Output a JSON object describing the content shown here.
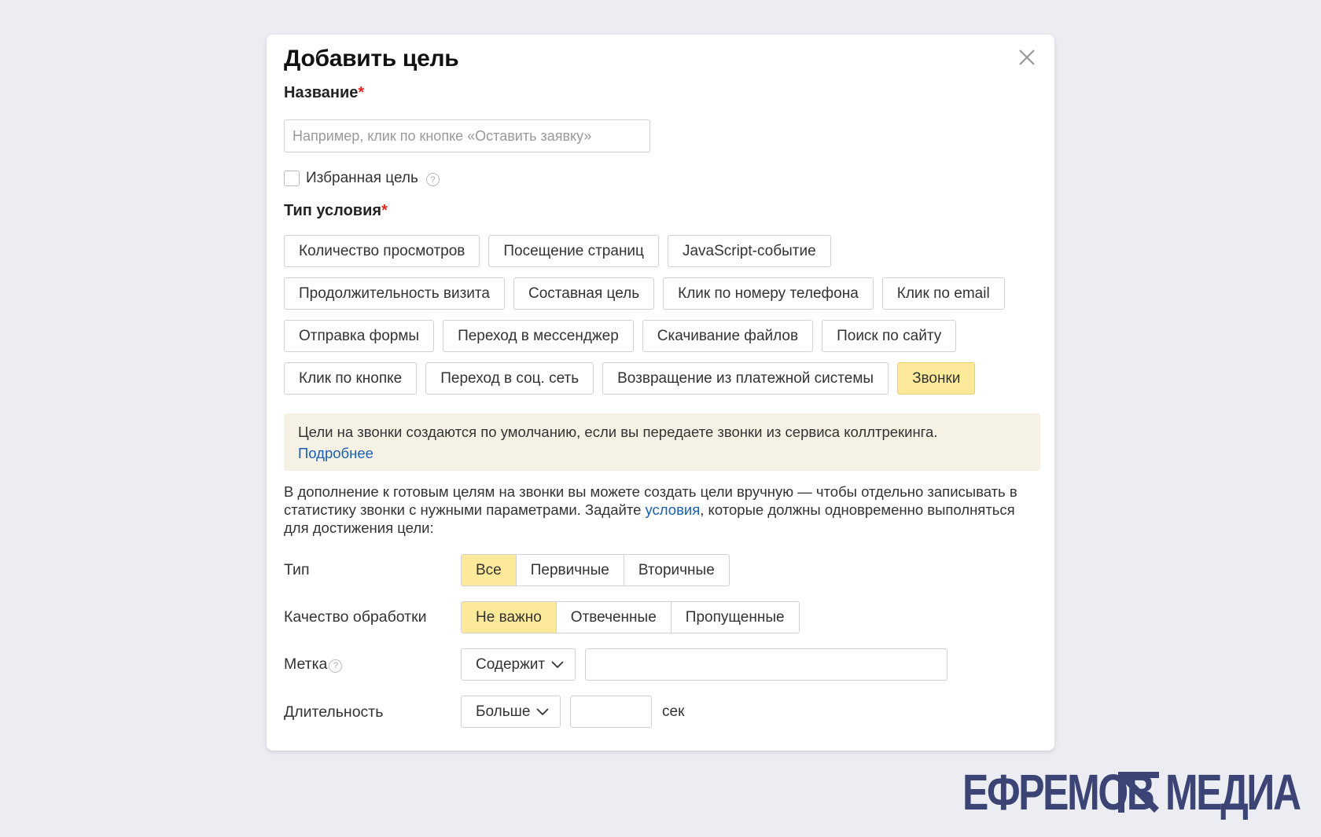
{
  "dialog": {
    "title": "Добавить цель",
    "close_icon": "close-icon"
  },
  "name_field": {
    "label": "Название",
    "required_mark": "*",
    "placeholder": "Например, клик по кнопке «Оставить заявку»",
    "value": ""
  },
  "favorite": {
    "label": "Избранная цель",
    "checked": false,
    "help_icon": "question-circle-icon"
  },
  "condition_type": {
    "label": "Тип условия",
    "required_mark": "*",
    "rows": [
      [
        "Количество просмотров",
        "Посещение страниц",
        "JavaScript-событие"
      ],
      [
        "Продолжительность визита",
        "Составная цель",
        "Клик по номеру телефона",
        "Клик по email"
      ],
      [
        "Отправка формы",
        "Переход в мессенджер",
        "Скачивание файлов",
        "Поиск по сайту"
      ],
      [
        "Клик по кнопке",
        "Переход в соц. сеть",
        "Возвращение из платежной системы",
        "Звонки"
      ]
    ],
    "selected": "Звонки"
  },
  "info": {
    "text": "Цели на звонки создаются по умолчанию, если вы передаете звонки из сервиса коллтрекинга.",
    "link": "Подробнее"
  },
  "description": {
    "before_link": "В дополнение к готовым целям на звонки вы можете создать цели вручную — чтобы отдельно записывать в статистику звонки с нужными параметрами. Задайте ",
    "link": "условия",
    "after_link": ", которые должны одновременно выполняться для достижения цели:"
  },
  "call_type": {
    "label": "Тип",
    "options": [
      "Все",
      "Первичные",
      "Вторичные"
    ],
    "selected": "Все"
  },
  "quality": {
    "label": "Качество обработки",
    "options": [
      "Не важно",
      "Отвеченные",
      "Пропущенные"
    ],
    "selected": "Не важно"
  },
  "tag": {
    "label": "Метка",
    "help_icon": "question-circle-icon",
    "operator": "Содержит",
    "value": ""
  },
  "duration": {
    "label": "Длительность",
    "operator": "Больше",
    "value": "",
    "unit": "сек"
  },
  "watermark": {
    "left": "ЕФРЕМОВ",
    "right": "МЕДИА",
    "color": "#3b4474"
  },
  "colors": {
    "active_chip": "#fde99a",
    "info_bg": "#f6f1e5",
    "link": "#1a5fb4",
    "required": "#e0281e"
  }
}
